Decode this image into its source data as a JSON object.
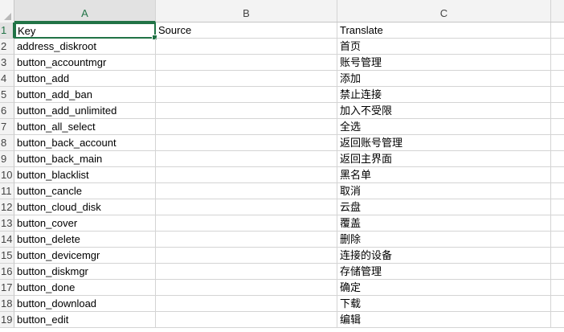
{
  "columns": [
    "A",
    "B",
    "C"
  ],
  "rows": [
    {
      "num": "1",
      "key": "Key",
      "source": "Source",
      "translate": "Translate"
    },
    {
      "num": "2",
      "key": "address_diskroot",
      "source": "",
      "translate": "首页"
    },
    {
      "num": "3",
      "key": "button_accountmgr",
      "source": "",
      "translate": "账号管理"
    },
    {
      "num": "4",
      "key": "button_add",
      "source": "",
      "translate": "添加"
    },
    {
      "num": "5",
      "key": "button_add_ban",
      "source": "",
      "translate": "禁止连接"
    },
    {
      "num": "6",
      "key": "button_add_unlimited",
      "source": "",
      "translate": "加入不受限"
    },
    {
      "num": "7",
      "key": "button_all_select",
      "source": "",
      "translate": "全选"
    },
    {
      "num": "8",
      "key": "button_back_account",
      "source": "",
      "translate": "返回账号管理"
    },
    {
      "num": "9",
      "key": "button_back_main",
      "source": "",
      "translate": "返回主界面"
    },
    {
      "num": "10",
      "key": "button_blacklist",
      "source": "",
      "translate": "黑名单"
    },
    {
      "num": "11",
      "key": "button_cancle",
      "source": "",
      "translate": "取消"
    },
    {
      "num": "12",
      "key": "button_cloud_disk",
      "source": "",
      "translate": "云盘"
    },
    {
      "num": "13",
      "key": "button_cover",
      "source": "",
      "translate": "覆盖"
    },
    {
      "num": "14",
      "key": "button_delete",
      "source": "",
      "translate": "删除"
    },
    {
      "num": "15",
      "key": "button_devicemgr",
      "source": "",
      "translate": "连接的设备"
    },
    {
      "num": "16",
      "key": "button_diskmgr",
      "source": "",
      "translate": "存储管理"
    },
    {
      "num": "17",
      "key": "button_done",
      "source": "",
      "translate": "确定"
    },
    {
      "num": "18",
      "key": "button_download",
      "source": "",
      "translate": "下载"
    },
    {
      "num": "19",
      "key": "button_edit",
      "source": "",
      "translate": "编辑"
    }
  ],
  "selected_cell": "A1",
  "colors": {
    "selection": "#217346",
    "header_bg": "#f3f3f3",
    "gridline": "#d4d4d4"
  }
}
